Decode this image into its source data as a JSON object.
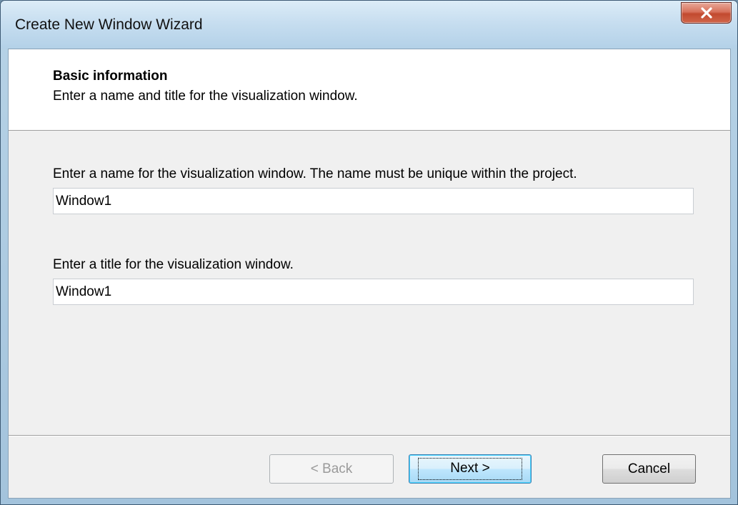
{
  "window": {
    "title": "Create New Window Wizard",
    "close_icon": "close-icon"
  },
  "header": {
    "title": "Basic information",
    "subtitle": "Enter a name and title for the visualization window."
  },
  "name_field": {
    "label": "Enter a name for the visualization window. The name must be unique within the project.",
    "value": "Window1"
  },
  "title_field": {
    "label": "Enter a title for the visualization window.",
    "value": "Window1"
  },
  "buttons": {
    "back": "< Back",
    "next": "Next >",
    "cancel": "Cancel"
  },
  "colors": {
    "close_button": "#c24a2f",
    "dialog_background": "#f0f0f0",
    "default_button_border": "#3c7fb1"
  }
}
